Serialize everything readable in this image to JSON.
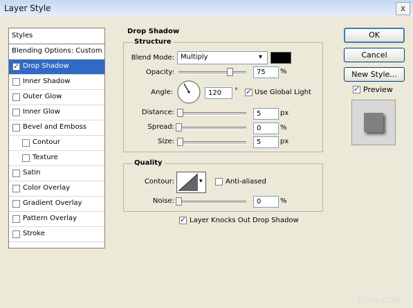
{
  "window": {
    "title": "Layer Style",
    "close_label": "x"
  },
  "styles_panel": {
    "header": "Styles",
    "items": [
      {
        "label": "Blending Options: Custom",
        "checkbox": false,
        "checked": false,
        "selected": false,
        "indent": false
      },
      {
        "label": "Drop Shadow",
        "checkbox": true,
        "checked": true,
        "selected": true,
        "indent": false
      },
      {
        "label": "Inner Shadow",
        "checkbox": true,
        "checked": false,
        "selected": false,
        "indent": false
      },
      {
        "label": "Outer Glow",
        "checkbox": true,
        "checked": false,
        "selected": false,
        "indent": false
      },
      {
        "label": "Inner Glow",
        "checkbox": true,
        "checked": false,
        "selected": false,
        "indent": false
      },
      {
        "label": "Bevel and Emboss",
        "checkbox": true,
        "checked": false,
        "selected": false,
        "indent": false
      },
      {
        "label": "Contour",
        "checkbox": true,
        "checked": false,
        "selected": false,
        "indent": true
      },
      {
        "label": "Texture",
        "checkbox": true,
        "checked": false,
        "selected": false,
        "indent": true
      },
      {
        "label": "Satin",
        "checkbox": true,
        "checked": false,
        "selected": false,
        "indent": false
      },
      {
        "label": "Color Overlay",
        "checkbox": true,
        "checked": false,
        "selected": false,
        "indent": false
      },
      {
        "label": "Gradient Overlay",
        "checkbox": true,
        "checked": false,
        "selected": false,
        "indent": false
      },
      {
        "label": "Pattern Overlay",
        "checkbox": true,
        "checked": false,
        "selected": false,
        "indent": false
      },
      {
        "label": "Stroke",
        "checkbox": true,
        "checked": false,
        "selected": false,
        "indent": false
      }
    ]
  },
  "drop_shadow": {
    "title": "Drop Shadow",
    "structure": {
      "title": "Structure",
      "blend_mode_label": "Blend Mode:",
      "blend_mode_value": "Multiply",
      "shadow_color": "#000000",
      "opacity_label": "Opacity:",
      "opacity_value": "75",
      "opacity_unit": "%",
      "opacity_level": 0.75,
      "angle_label": "Angle:",
      "angle_value": "120",
      "angle_unit": "°",
      "angle_degrees": 120,
      "use_global_light_label": "Use Global Light",
      "use_global_light": true,
      "distance_label": "Distance:",
      "distance_value": "5",
      "distance_unit": "px",
      "distance_level": 0.02,
      "spread_label": "Spread:",
      "spread_value": "0",
      "spread_unit": "%",
      "spread_level": 0.0,
      "size_label": "Size:",
      "size_value": "5",
      "size_unit": "px",
      "size_level": 0.02
    },
    "quality": {
      "title": "Quality",
      "contour_label": "Contour:",
      "anti_aliased_label": "Anti-aliased",
      "anti_aliased": false,
      "noise_label": "Noise:",
      "noise_value": "0",
      "noise_unit": "%",
      "noise_level": 0.0
    },
    "knockout_label": "Layer Knocks Out Drop Shadow",
    "knockout": true
  },
  "buttons": {
    "ok": "OK",
    "cancel": "Cancel",
    "new_style": "New Style..."
  },
  "preview": {
    "label": "Preview",
    "checked": true
  },
  "watermark": "OUHe.COM",
  "colors": {
    "selection": "#316ac5",
    "dialog_bg": "#ece9d8",
    "preview_square": "#808080"
  }
}
